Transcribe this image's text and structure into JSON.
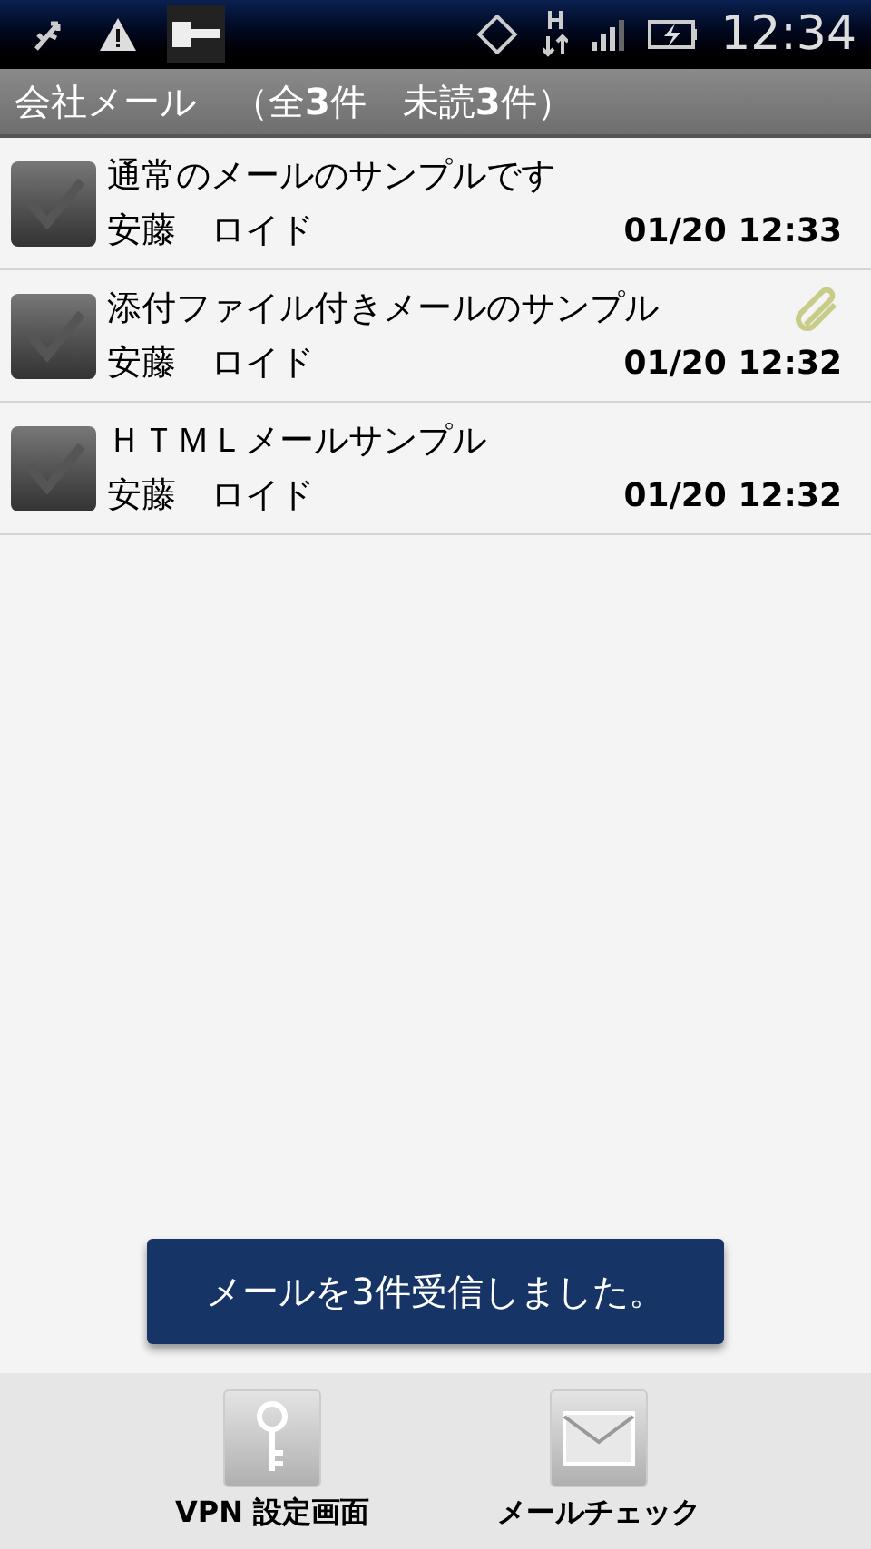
{
  "status_bar": {
    "time": "12:34"
  },
  "title_bar": {
    "title": "会社メール　（全**3**件　未読**3**件）"
  },
  "mails": [
    {
      "subject": "通常のメールのサンプルです",
      "sender": "安藤　ロイド",
      "time": "01/20 12:33",
      "checked": true,
      "attachment": false
    },
    {
      "subject": "添付ファイル付きメールのサンプル",
      "sender": "安藤　ロイド",
      "time": "01/20 12:32",
      "checked": true,
      "attachment": true
    },
    {
      "subject": "ＨＴＭＬメールサンプル",
      "sender": "安藤　ロイド",
      "time": "01/20 12:32",
      "checked": true,
      "attachment": false
    }
  ],
  "toast": {
    "text": "メールを3件受信しました。"
  },
  "bottom_buttons": [
    {
      "kind": "key",
      "label": "VPN 設定画面"
    },
    {
      "kind": "mail",
      "label": "メールチェック"
    }
  ]
}
